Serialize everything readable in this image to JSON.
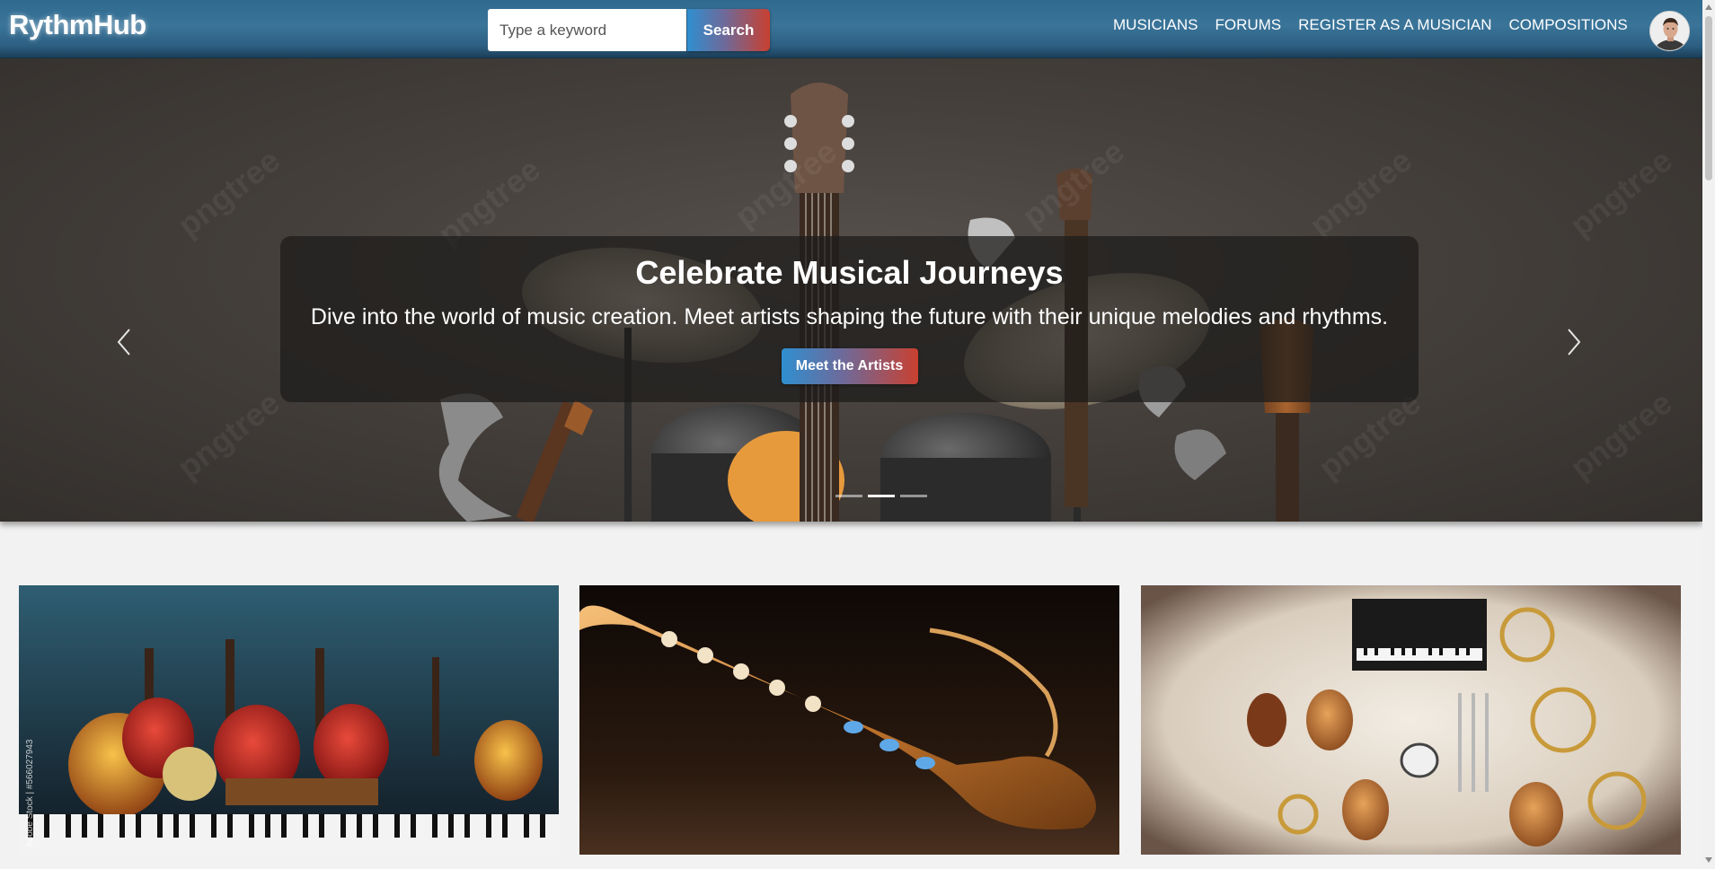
{
  "brand": {
    "name": "RythmHub"
  },
  "search": {
    "placeholder": "Type a keyword",
    "button_label": "Search"
  },
  "nav": {
    "links": [
      {
        "label": "MUSICIANS"
      },
      {
        "label": "FORUMS"
      },
      {
        "label": "REGISTER AS A MUSICIAN"
      },
      {
        "label": "COMPOSITIONS"
      }
    ],
    "avatar_icon": "user-avatar"
  },
  "hero": {
    "title": "Celebrate Musical Journeys",
    "text": "Dive into the world of music creation. Meet artists shaping the future with their unique melodies and rhythms.",
    "cta_label": "Meet the Artists",
    "watermark": "pngtree",
    "slides_count": 3,
    "active_slide": 2,
    "prev_icon": "chevron-left-icon",
    "next_icon": "chevron-right-icon"
  },
  "gallery": {
    "cards": [
      {
        "image": "guitars-and-instruments",
        "watermark": "Adobe Stock | #566027943"
      },
      {
        "image": "saxophone"
      },
      {
        "image": "instrument-collection"
      }
    ]
  },
  "colors": {
    "nav_bg": "#2f6a8f",
    "gradient_start": "#2f8fd0",
    "gradient_end": "#c94030",
    "page_bg": "#f2f2f2"
  }
}
